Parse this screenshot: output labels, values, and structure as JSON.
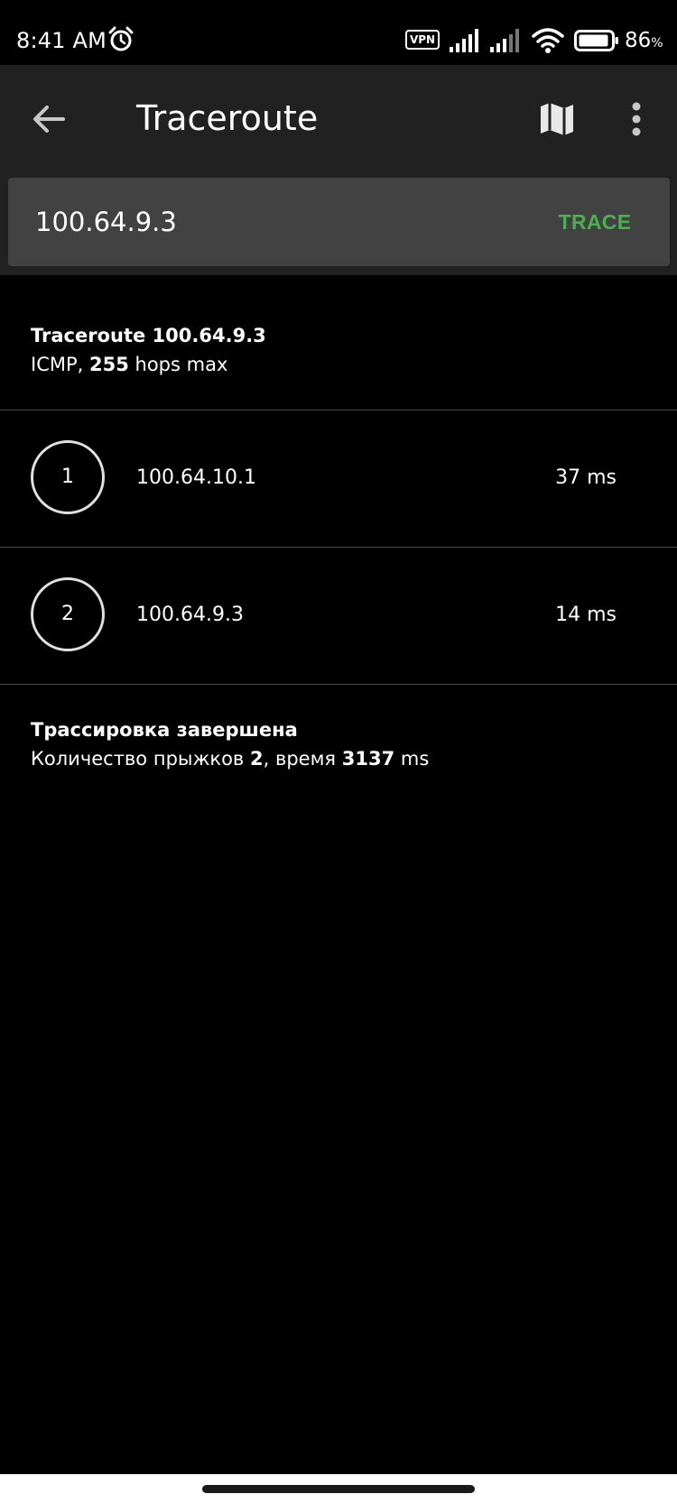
{
  "status_bar": {
    "time": "8:41 AM",
    "vpn_label": "VPN",
    "battery_percent": "86",
    "battery_unit": "%",
    "icons": [
      "alarm-icon",
      "vpn-icon",
      "signal-icon",
      "signal-icon",
      "wifi-icon",
      "battery-icon"
    ]
  },
  "toolbar": {
    "title": "Traceroute",
    "icons": [
      "back-arrow-icon",
      "map-icon",
      "more-vert-icon"
    ]
  },
  "input": {
    "value": "100.64.9.3",
    "trace_label": "TRACE"
  },
  "header": {
    "title": "Traceroute 100.64.9.3",
    "protocol": "ICMP, ",
    "max_hops": "255",
    "hops_suffix": " hops max"
  },
  "hops": [
    {
      "number": "1",
      "ip": "100.64.10.1",
      "time": "37 ms"
    },
    {
      "number": "2",
      "ip": "100.64.9.3",
      "time": "14 ms"
    }
  ],
  "footer": {
    "title": "Трассировка завершена",
    "count_prefix": "Количество прыжков ",
    "count": "2",
    "time_prefix": ", время ",
    "time": "3137",
    "time_unit": " ms"
  },
  "colors": {
    "background": "#000000",
    "toolbar": "#212121",
    "input_box": "#424242",
    "accent": "#4caf50",
    "divider": "#4a4a4a"
  }
}
